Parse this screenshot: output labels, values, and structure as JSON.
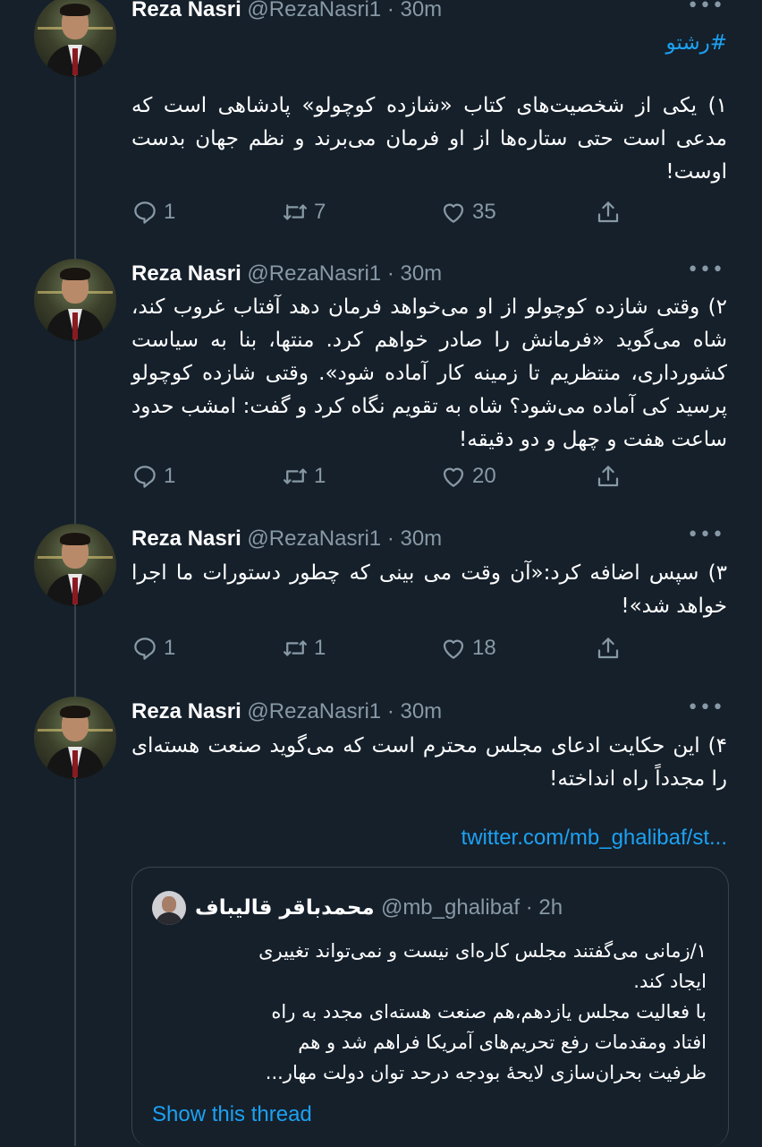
{
  "tweets": [
    {
      "name": "Reza Nasri",
      "handle": "@RezaNasri1",
      "time": "30m",
      "hashtag": "#رشتو",
      "text": "۱) یکی از شخصیت‌های کتاب «شازده کوچولو» پادشاهی است که مدعی است حتی ستاره‌ها از او فرمان می‌برند و نظم جهان بدست اوست!",
      "replies": "1",
      "retweets": "7",
      "likes": "35"
    },
    {
      "name": "Reza Nasri",
      "handle": "@RezaNasri1",
      "time": "30m",
      "text": "۲) وقتی شازده کوچولو از او می‌خواهد فرمان دهد آفتاب غروب کند، شاه می‌گوید «فرمانش را صادر خواهم کرد. منتها، بنا به سیاست کشورداری، منتظریم تا زمینه کار آماده شود». وقتی شازده کوچولو پرسید کی آماده می‌شود؟ شاه به تقویم نگاه کرد و گفت: امشب حدود ساعت هفت و چهل و دو دقیقه!",
      "replies": "1",
      "retweets": "1",
      "likes": "20"
    },
    {
      "name": "Reza Nasri",
      "handle": "@RezaNasri1",
      "time": "30m",
      "text": "۳) سپس اضافه کرد:«آن وقت می بینی که چطور دستورات ما اجرا خواهد شد»!",
      "replies": "1",
      "retweets": "1",
      "likes": "18"
    },
    {
      "name": "Reza Nasri",
      "handle": "@RezaNasri1",
      "time": "30m",
      "text": "۴) این حکایت ادعای مجلس محترم است که می‌گوید صنعت هسته‌ای را مجدداً راه انداخته!",
      "link": "twitter.com/mb_ghalibaf/st...",
      "quote": {
        "name": "محمدباقر قالیباف",
        "handle": "@mb_ghalibaf",
        "time": "2h",
        "lines": [
          "۱/زمانی می‌گفتند مجلس کاره‌ای نیست و نمی‌تواند تغییری",
          "ایجاد کند.",
          "با فعالیت مجلس یازدهم،هم صنعت هسته‌ای مجدد به راه",
          "افتاد ومقدمات رفع تحریم‌های آمریکا فراهم شد و هم",
          "ظرفیت بحران‌سازی  لایحهٔ بودجه درحد توان دولت مهار..."
        ],
        "show_thread": "Show this thread"
      }
    }
  ],
  "icons": {
    "reply": "reply-icon",
    "retweet": "retweet-icon",
    "like": "heart-icon",
    "share": "share-icon",
    "more": "more-icon"
  },
  "colors": {
    "background": "#15202b",
    "accent": "#1da1f2",
    "muted": "#8899a6",
    "border": "#38444d"
  }
}
